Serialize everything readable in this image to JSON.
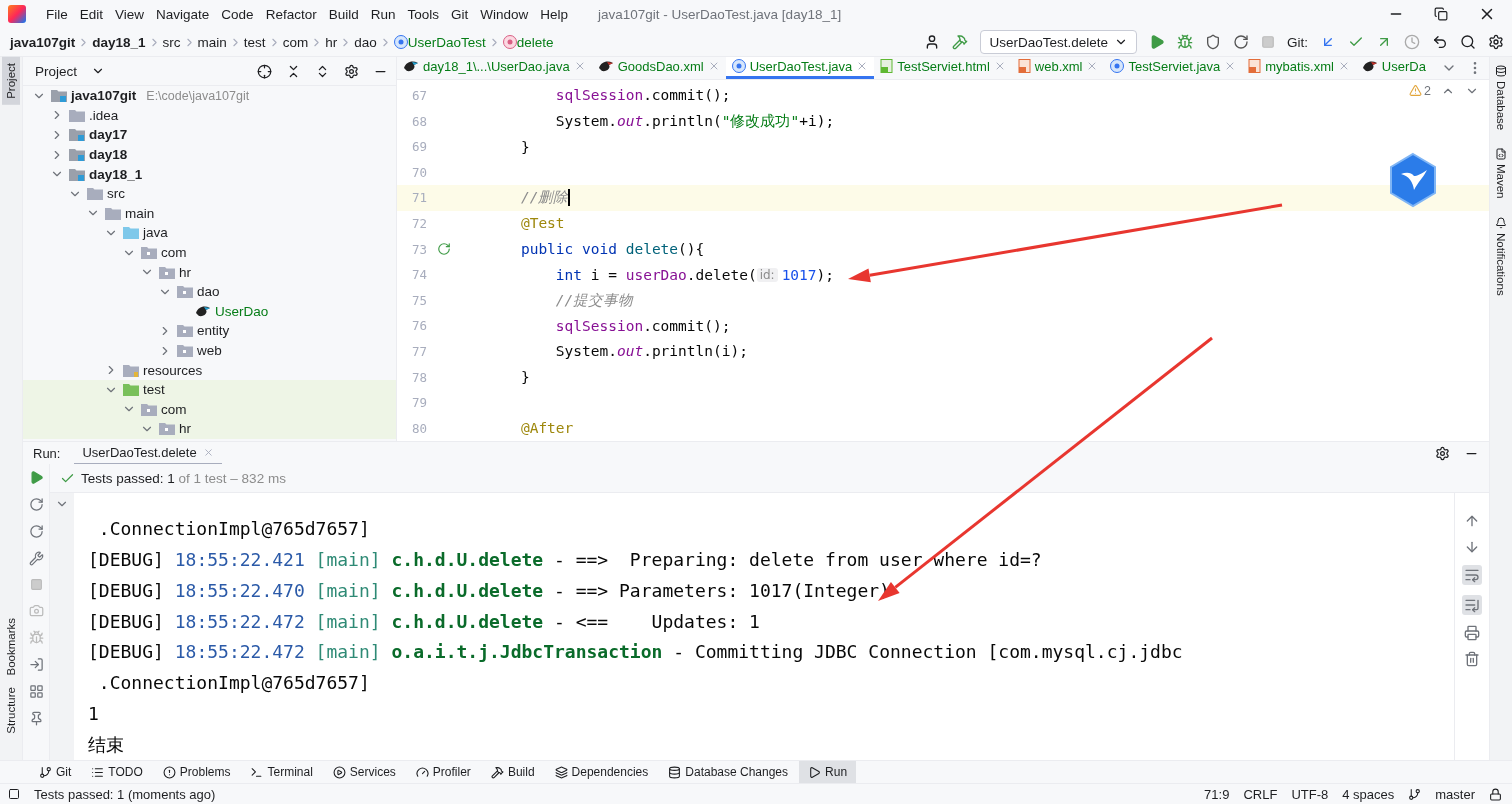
{
  "window": {
    "title": "java107git - UserDaoTest.java [day18_1]"
  },
  "menu": [
    "File",
    "Edit",
    "View",
    "Navigate",
    "Code",
    "Refactor",
    "Build",
    "Run",
    "Tools",
    "Git",
    "Window",
    "Help"
  ],
  "breadcrumbs": [
    {
      "label": "java107git",
      "kind": "project"
    },
    {
      "label": "day18_1",
      "kind": "project"
    },
    {
      "label": "src",
      "kind": "plain"
    },
    {
      "label": "main",
      "kind": "plain"
    },
    {
      "label": "test",
      "kind": "plain"
    },
    {
      "label": "com",
      "kind": "plain"
    },
    {
      "label": "hr",
      "kind": "plain"
    },
    {
      "label": "dao",
      "kind": "plain"
    },
    {
      "label": "UserDaoTest",
      "kind": "class"
    },
    {
      "label": "delete",
      "kind": "method"
    }
  ],
  "toolbar": {
    "run_config": "UserDaoTest.delete",
    "git_label": "Git:"
  },
  "left_stripe": [
    {
      "label": "Project",
      "selected": true
    },
    {
      "label": "Bookmarks",
      "selected": false
    },
    {
      "label": "Structure",
      "selected": false
    }
  ],
  "right_stripe": [
    {
      "label": "Database",
      "kind": "database"
    },
    {
      "label": "Maven",
      "kind": "maven"
    },
    {
      "label": "Notifications",
      "kind": "notifications"
    }
  ],
  "project_panel": {
    "title": "Project",
    "tree": [
      {
        "label": "java107git",
        "path": "E:\\code\\java107git",
        "kind": "module",
        "expanded": true,
        "children": [
          {
            "label": ".idea",
            "kind": "folder",
            "expanded": false
          },
          {
            "label": "day17",
            "kind": "module",
            "expanded": false
          },
          {
            "label": "day18",
            "kind": "module",
            "expanded": false
          },
          {
            "label": "day18_1",
            "kind": "module",
            "expanded": true,
            "children": [
              {
                "label": "src",
                "kind": "folder",
                "expanded": true,
                "children": [
                  {
                    "label": "main",
                    "kind": "folder",
                    "expanded": true,
                    "children": [
                      {
                        "label": "java",
                        "kind": "source",
                        "expanded": true,
                        "children": [
                          {
                            "label": "com",
                            "kind": "package",
                            "expanded": true,
                            "children": [
                              {
                                "label": "hr",
                                "kind": "package",
                                "expanded": true,
                                "children": [
                                  {
                                    "label": "dao",
                                    "kind": "package",
                                    "expanded": true,
                                    "children": [
                                      {
                                        "label": "UserDao",
                                        "kind": "mapper"
                                      }
                                    ]
                                  },
                                  {
                                    "label": "entity",
                                    "kind": "package",
                                    "expanded": false
                                  },
                                  {
                                    "label": "web",
                                    "kind": "package",
                                    "expanded": false
                                  }
                                ]
                              }
                            ]
                          }
                        ]
                      },
                      {
                        "label": "resources",
                        "kind": "resources",
                        "expanded": false
                      },
                      {
                        "label": "test",
                        "kind": "test",
                        "expanded": true,
                        "children": [
                          {
                            "label": "com",
                            "kind": "package",
                            "expanded": true,
                            "children": [
                              {
                                "label": "hr",
                                "kind": "package",
                                "expanded": true
                              }
                            ]
                          }
                        ]
                      }
                    ]
                  }
                ]
              }
            ]
          }
        ]
      }
    ]
  },
  "editor_tabs": [
    {
      "label": "day18_1\\...\\UserDao.java",
      "kind": "mapper",
      "selected": false,
      "closable": true
    },
    {
      "label": "GoodsDao.xml",
      "kind": "mapper-xml",
      "selected": false,
      "closable": true
    },
    {
      "label": "UserDaoTest.java",
      "kind": "class",
      "selected": true,
      "closable": true
    },
    {
      "label": "TestServiet.html",
      "kind": "html",
      "selected": false,
      "closable": true
    },
    {
      "label": "web.xml",
      "kind": "xml",
      "selected": false,
      "closable": true
    },
    {
      "label": "TestServiet.java",
      "kind": "class",
      "selected": false,
      "closable": true
    },
    {
      "label": "mybatis.xml",
      "kind": "xml",
      "selected": false,
      "closable": true
    },
    {
      "label": "UserDa",
      "kind": "mapper-xml",
      "selected": false,
      "closable": false
    }
  ],
  "inspections": {
    "warnings": "2"
  },
  "code": [
    {
      "number": "67",
      "current": false,
      "runnable": false,
      "tokens": [
        {
          "kind": "field",
          "text": "        sqlSession"
        },
        {
          "kind": "plain",
          "text": ".commit();"
        }
      ]
    },
    {
      "number": "68",
      "current": false,
      "runnable": false,
      "tokens": [
        {
          "kind": "plain",
          "text": "        System."
        },
        {
          "kind": "static",
          "text": "out"
        },
        {
          "kind": "plain",
          "text": ".println("
        },
        {
          "kind": "string",
          "text": "\"修改成功\""
        },
        {
          "kind": "plain",
          "text": "+i);"
        }
      ]
    },
    {
      "number": "69",
      "current": false,
      "runnable": false,
      "tokens": [
        {
          "kind": "plain",
          "text": "    }"
        }
      ]
    },
    {
      "number": "70",
      "current": false,
      "runnable": false
    },
    {
      "number": "71",
      "current": true,
      "runnable": false,
      "tokens": [
        {
          "kind": "comment",
          "text": "    //删除"
        }
      ]
    },
    {
      "number": "72",
      "current": false,
      "runnable": false,
      "tokens": [
        {
          "kind": "annotation",
          "text": "    @Test"
        }
      ]
    },
    {
      "number": "73",
      "current": false,
      "runnable": true,
      "tokens": [
        {
          "kind": "keyword",
          "text": "    public void "
        },
        {
          "kind": "method",
          "text": "delete"
        },
        {
          "kind": "plain",
          "text": "(){"
        }
      ]
    },
    {
      "number": "74",
      "current": false,
      "runnable": false,
      "tokens": [
        {
          "kind": "keyword",
          "text": "        int "
        },
        {
          "kind": "plain",
          "text": "i = "
        },
        {
          "kind": "field",
          "text": "userDao"
        },
        {
          "kind": "plain",
          "text": ".delete("
        },
        {
          "kind": "hint",
          "text": "id:"
        },
        {
          "kind": "number",
          "text": "1017"
        },
        {
          "kind": "plain",
          "text": ");"
        }
      ]
    },
    {
      "number": "75",
      "current": false,
      "runnable": false,
      "tokens": [
        {
          "kind": "comment",
          "text": "        //提交事物"
        }
      ]
    },
    {
      "number": "76",
      "current": false,
      "runnable": false,
      "tokens": [
        {
          "kind": "field",
          "text": "        sqlSession"
        },
        {
          "kind": "plain",
          "text": ".commit();"
        }
      ]
    },
    {
      "number": "77",
      "current": false,
      "runnable": false,
      "tokens": [
        {
          "kind": "plain",
          "text": "        System."
        },
        {
          "kind": "static",
          "text": "out"
        },
        {
          "kind": "plain",
          "text": ".println(i);"
        }
      ]
    },
    {
      "number": "78",
      "current": false,
      "runnable": false,
      "tokens": [
        {
          "kind": "plain",
          "text": "    }"
        }
      ]
    },
    {
      "number": "79",
      "current": false,
      "runnable": false
    },
    {
      "number": "80",
      "current": false,
      "runnable": false,
      "tokens": [
        {
          "kind": "annotation",
          "text": "    @After"
        }
      ]
    }
  ],
  "run_panel": {
    "label": "Run:",
    "tab": "UserDaoTest.delete",
    "status": {
      "passed": "Tests passed: 1",
      "detail": "of 1 test – 832 ms"
    },
    "console": [
      [
        {
          "kind": "plain",
          "text": " .ConnectionImpl@765d7657]"
        }
      ],
      [
        {
          "kind": "plain",
          "text": "[DEBUG] "
        },
        {
          "kind": "time",
          "text": "18:55:22.421"
        },
        {
          "kind": "thread",
          "text": " [main] "
        },
        {
          "kind": "logger",
          "text": "c.h.d.U.delete"
        },
        {
          "kind": "plain",
          "text": " - ==>  Preparing: delete from user where id=?"
        }
      ],
      [
        {
          "kind": "plain",
          "text": "[DEBUG] "
        },
        {
          "kind": "time",
          "text": "18:55:22.470"
        },
        {
          "kind": "thread",
          "text": " [main] "
        },
        {
          "kind": "logger",
          "text": "c.h.d.U.delete"
        },
        {
          "kind": "plain",
          "text": " - ==> Parameters: 1017(Integer)"
        }
      ],
      [
        {
          "kind": "plain",
          "text": "[DEBUG] "
        },
        {
          "kind": "time",
          "text": "18:55:22.472"
        },
        {
          "kind": "thread",
          "text": " [main] "
        },
        {
          "kind": "logger",
          "text": "c.h.d.U.delete"
        },
        {
          "kind": "plain",
          "text": " - <==    Updates: 1"
        }
      ],
      [
        {
          "kind": "plain",
          "text": "[DEBUG] "
        },
        {
          "kind": "time",
          "text": "18:55:22.472"
        },
        {
          "kind": "thread",
          "text": " [main] "
        },
        {
          "kind": "logger",
          "text": "o.a.i.t.j.JdbcTransaction"
        },
        {
          "kind": "plain",
          "text": " - Committing JDBC Connection [com.mysql.cj.jdbc"
        }
      ],
      [
        {
          "kind": "plain",
          "text": " .ConnectionImpl@765d7657]"
        }
      ],
      [
        {
          "kind": "plain",
          "text": "1"
        }
      ],
      [
        {
          "kind": "plain",
          "text": "结束"
        }
      ]
    ]
  },
  "tool_windows": [
    {
      "label": "Git",
      "kind": "git",
      "selected": false
    },
    {
      "label": "TODO",
      "kind": "todo",
      "selected": false
    },
    {
      "label": "Problems",
      "kind": "problems",
      "selected": false
    },
    {
      "label": "Terminal",
      "kind": "terminal",
      "selected": false
    },
    {
      "label": "Services",
      "kind": "services",
      "selected": false
    },
    {
      "label": "Profiler",
      "kind": "profiler",
      "selected": false
    },
    {
      "label": "Build",
      "kind": "build",
      "selected": false
    },
    {
      "label": "Dependencies",
      "kind": "dependencies",
      "selected": false
    },
    {
      "label": "Database Changes",
      "kind": "database",
      "selected": false
    },
    {
      "label": "Run",
      "kind": "run",
      "selected": true
    }
  ],
  "status_bar": {
    "message": "Tests passed: 1 (moments ago)",
    "items": [
      "71:9",
      "CRLF",
      "UTF-8",
      "4 spaces"
    ],
    "branch": "master"
  }
}
